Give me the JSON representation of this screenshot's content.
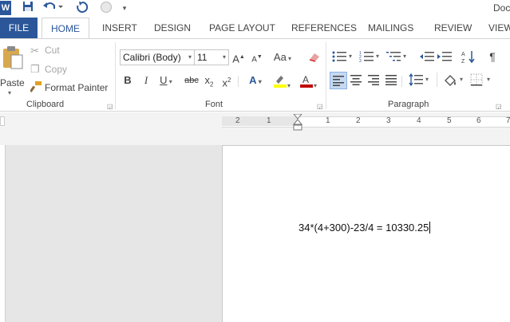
{
  "app": {
    "title": "Doc",
    "logo_letter": "W"
  },
  "tabs": [
    "FILE",
    "HOME",
    "INSERT",
    "DESIGN",
    "PAGE LAYOUT",
    "REFERENCES",
    "MAILINGS",
    "REVIEW",
    "VIEW"
  ],
  "clipboard": {
    "paste": "Paste",
    "cut": "Cut",
    "copy": "Copy",
    "format_painter": "Format Painter",
    "label": "Clipboard"
  },
  "font": {
    "name": "Calibri (Body)",
    "size": "11",
    "grow": "A",
    "shrink": "A",
    "change_case": "Aa",
    "bold": "B",
    "italic": "I",
    "underline": "U",
    "strike": "abc",
    "subscript": "x",
    "superscript": "x",
    "subscript_mark": "2",
    "superscript_mark": "2",
    "label": "Font",
    "highlight_color": "#ffff00",
    "font_color": "#c00000"
  },
  "paragraph": {
    "label": "Paragraph",
    "pilcrow": "¶"
  },
  "ruler": {
    "left_numbers": [
      "2",
      "1"
    ],
    "right_numbers": [
      "1",
      "2",
      "3",
      "4",
      "5",
      "6",
      "7"
    ]
  },
  "document": {
    "text": "34*(4+300)-23/4 = 10330.25"
  },
  "colors": {
    "accent": "#2b579a"
  }
}
